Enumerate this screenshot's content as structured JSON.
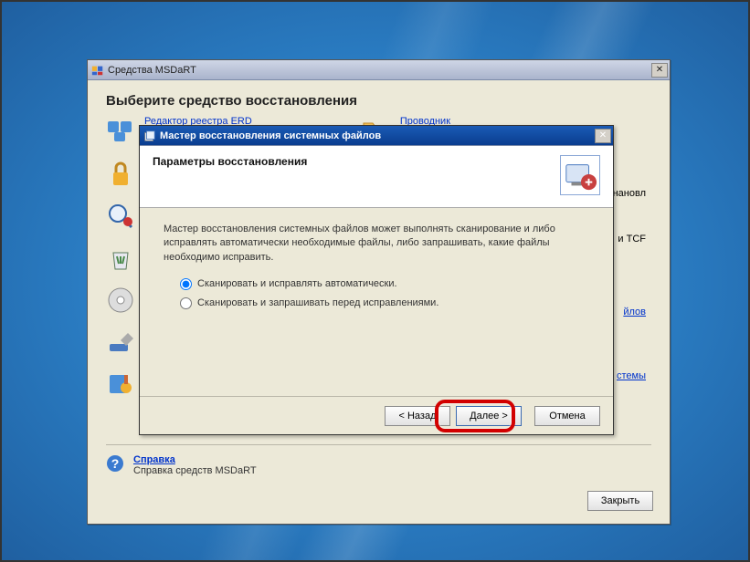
{
  "parent": {
    "title": "Средства MSDaRT",
    "heading": "Выберите средство восстановления",
    "registry_link": "Редактор реестра ERD",
    "explorer_link": "Проводник",
    "right_text_1": "нановл",
    "right_text_2": "и TCF",
    "right_link_files": "йлов",
    "right_link_system": "стемы",
    "help_link": "Справка",
    "help_desc": "Справка средств MSDaRT",
    "close_btn": "Закрыть"
  },
  "wizard": {
    "title": "Мастер восстановления системных файлов",
    "header_title": "Параметры восстановления",
    "body_text": "Мастер восстановления системных файлов может выполнять сканирование и либо исправлять автоматически необходимые файлы, либо запрашивать, какие файлы необходимо исправить.",
    "radio1": "Сканировать и исправлять автоматически.",
    "radio2": "Сканировать и запрашивать перед исправлениями.",
    "back": "< Назад",
    "next": "Далее >",
    "cancel": "Отмена"
  }
}
